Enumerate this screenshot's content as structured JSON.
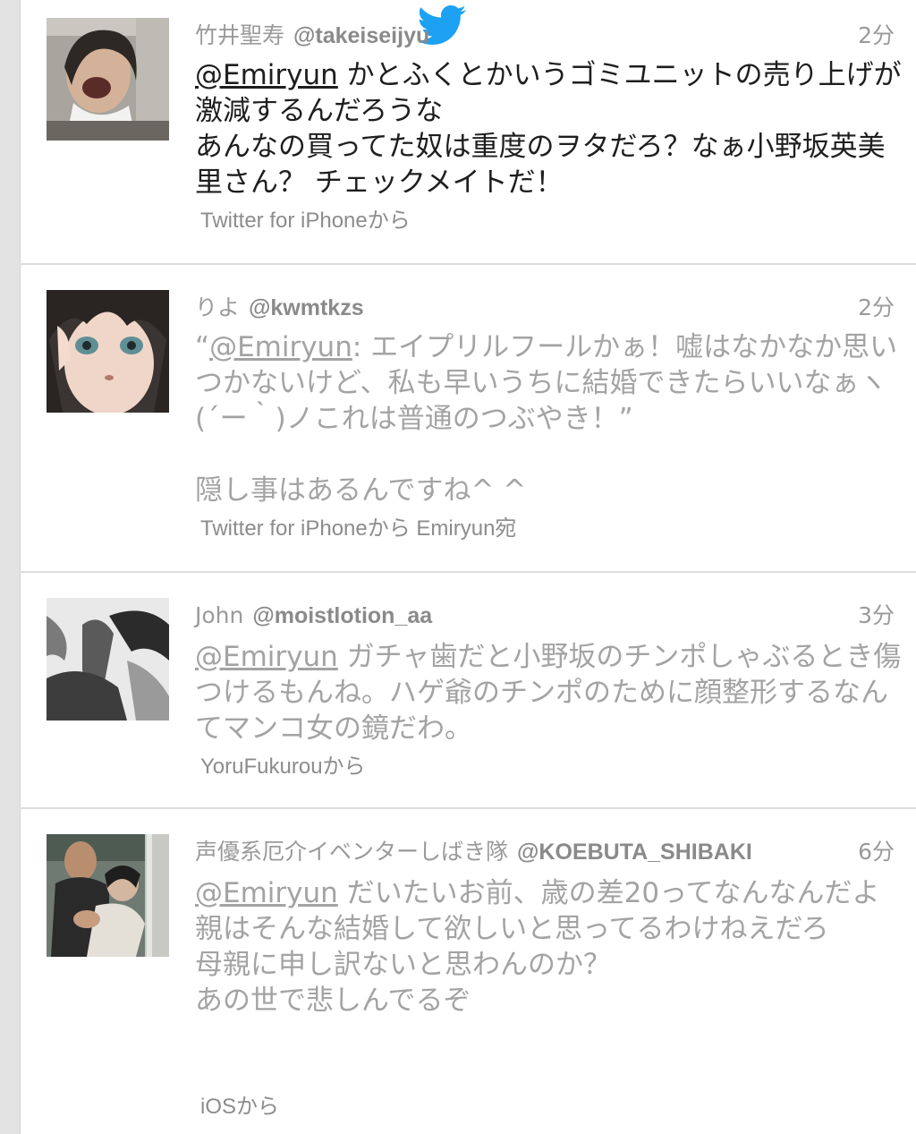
{
  "brand_color": "#1da1f2",
  "bird_icon": "twitter-bird-icon",
  "tweets": [
    {
      "name": "竹井聖寿",
      "handle": "@takeiseijyu",
      "time": "2分",
      "mention": "@Emiryun",
      "text": " かとふくとかいうゴミユニットの売り上げが激減するんだろうな\nあんなの買ってた奴は重度のヲタだろ？なぁ小野坂英美里さん？ チェックメイトだ！",
      "source": "Twitter for iPhoneから"
    },
    {
      "name": "りよ",
      "handle": "@kwmtkzs",
      "time": "2分",
      "quote_open": "“",
      "mention": "@Emiryun",
      "text": ": エイプリルフールかぁ！嘘はなかなか思いつかないけど、私も早いうちに結婚できたらいいなぁヽ(´ー｀)ノこれは普通のつぶやき！”\n\n隠し事はあるんですね^ ^",
      "source": "Twitter for iPhoneから Emiryun宛"
    },
    {
      "name": "John",
      "handle": "@moistlotion_aa",
      "time": "3分",
      "mention": "@Emiryun",
      "text": " ガチャ歯だと小野坂のチンポしゃぶるとき傷つけるもんね。ハゲ爺のチンポのために顔整形するなんてマンコ女の鏡だわ。",
      "source": "YoruFukurouから"
    },
    {
      "name": "声優系厄介イベンターしばき隊",
      "handle": "@KOEBUTA_SHIBAKI",
      "time": "6分",
      "mention": "@Emiryun",
      "text": " だいたいお前、歳の差20ってなんなんだよ\n親はそんな結婚して欲しいと思ってるわけねえだろ\n母親に申し訳ないと思わんのか？\nあの世で悲しんでるぞ",
      "source": "iOSから"
    }
  ]
}
